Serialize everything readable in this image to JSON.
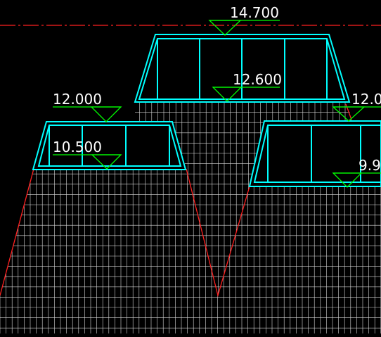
{
  "colors": {
    "background": "#000000",
    "gridline": "#d9d9d9",
    "slope_line": "#ff2020",
    "structure": "#00ffff",
    "marker": "#00ff00",
    "label_text": "#ffffff",
    "datum_line": "#ff2020"
  },
  "elevations": {
    "top_center": "14.700",
    "inner_center": "12.600",
    "top_left": "12.000",
    "inner_left": "10.500",
    "top_right": "12.0",
    "inner_right": "9.9"
  }
}
